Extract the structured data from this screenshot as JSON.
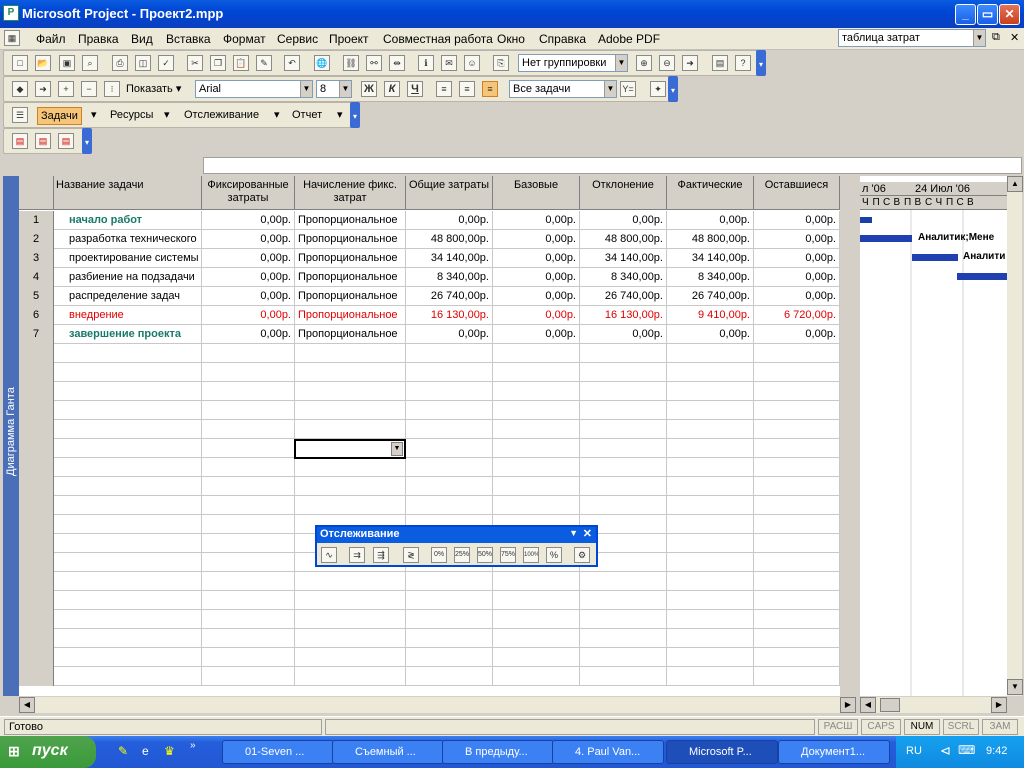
{
  "window": {
    "title": "Microsoft Project - Проект2.mpp",
    "icon": "ms-project-icon",
    "minimize": "_",
    "maximize": "▭",
    "close": "✕"
  },
  "menu": {
    "items": [
      {
        "label": "Файл"
      },
      {
        "label": "Правка"
      },
      {
        "label": "Вид"
      },
      {
        "label": "Вставка"
      },
      {
        "label": "Формат"
      },
      {
        "label": "Сервис"
      },
      {
        "label": "Проект"
      },
      {
        "label": "Совместная работа"
      },
      {
        "label": "Окно"
      },
      {
        "label": "Справка"
      },
      {
        "label": "Adobe PDF"
      }
    ],
    "ask_box": "таблица затрат"
  },
  "toolbar1": {
    "grouping": "Нет группировки"
  },
  "toolbar2": {
    "show_label": "Показать",
    "font": "Arial",
    "size": "8",
    "filter": "Все задачи",
    "bold": "Ж",
    "italic": "К",
    "underline": "Ч"
  },
  "toolbar3": {
    "tasks": "Задачи",
    "resources": "Ресурсы",
    "tracking": "Отслеживание",
    "report": "Отчет"
  },
  "entry_bar": {
    "value": ""
  },
  "view_bar": {
    "label": "Диаграмма Ганта"
  },
  "table": {
    "columns": [
      "Название задачи",
      "Фиксированные затраты",
      "Начисление фикс. затрат",
      "Общие затраты",
      "Базовые",
      "Отклонение",
      "Фактические",
      "Оставшиеся"
    ],
    "rows": [
      {
        "id": "1",
        "name": "начало работ",
        "fixed": "0,00р.",
        "accrual": "Пропорциональное",
        "total": "0,00р.",
        "baseline": "0,00р.",
        "variance": "0,00р.",
        "actual": "0,00р.",
        "remaining": "0,00р.",
        "style": "milestone"
      },
      {
        "id": "2",
        "name": "разработка технического",
        "fixed": "0,00р.",
        "accrual": "Пропорциональное",
        "total": "48 800,00р.",
        "baseline": "0,00р.",
        "variance": "48 800,00р.",
        "actual": "48 800,00р.",
        "remaining": "0,00р.",
        "style": "normal"
      },
      {
        "id": "3",
        "name": "проектирование системы",
        "fixed": "0,00р.",
        "accrual": "Пропорциональное",
        "total": "34 140,00р.",
        "baseline": "0,00р.",
        "variance": "34 140,00р.",
        "actual": "34 140,00р.",
        "remaining": "0,00р.",
        "style": "normal"
      },
      {
        "id": "4",
        "name": "разбиение на подзадачи",
        "fixed": "0,00р.",
        "accrual": "Пропорциональное",
        "total": "8 340,00р.",
        "baseline": "0,00р.",
        "variance": "8 340,00р.",
        "actual": "8 340,00р.",
        "remaining": "0,00р.",
        "style": "normal"
      },
      {
        "id": "5",
        "name": "распределение задач",
        "fixed": "0,00р.",
        "accrual": "Пропорциональное",
        "total": "26 740,00р.",
        "baseline": "0,00р.",
        "variance": "26 740,00р.",
        "actual": "26 740,00р.",
        "remaining": "0,00р.",
        "style": "normal"
      },
      {
        "id": "6",
        "name": "внедрение",
        "fixed": "0,00р.",
        "accrual": "Пропорциональное",
        "total": "16 130,00р.",
        "baseline": "0,00р.",
        "variance": "16 130,00р.",
        "actual": "9 410,00р.",
        "remaining": "6 720,00р.",
        "style": "critical"
      },
      {
        "id": "7",
        "name": "завершение проекта",
        "fixed": "0,00р.",
        "accrual": "Пропорциональное",
        "total": "0,00р.",
        "baseline": "0,00р.",
        "variance": "0,00р.",
        "actual": "0,00р.",
        "remaining": "0,00р.",
        "style": "milestone"
      }
    ],
    "empty_rows": 18
  },
  "gantt": {
    "week1": "л '06",
    "week2": "24 Июл '06",
    "days": [
      "Ч",
      "П",
      "С",
      "В",
      "П",
      "В",
      "С",
      "Ч",
      "П",
      "С",
      "В"
    ],
    "labels": [
      "Аналитик;Мене",
      "Аналити"
    ]
  },
  "tracking_toolbar": {
    "title": "Отслеживание",
    "pcts": [
      "0%",
      "25%",
      "50%",
      "75%",
      "100%"
    ]
  },
  "status": {
    "text": "Готово",
    "indicators": [
      "РАСШ",
      "CAPS",
      "NUM",
      "SCRL",
      "ЗАМ"
    ]
  },
  "taskbar": {
    "start": "пуск",
    "tasks": [
      "01-Seven ...",
      "Съемный ...",
      "В предыду...",
      "4. Paul Van...",
      "Microsoft P...",
      "Документ1..."
    ],
    "lang": "RU",
    "clock": "9:42"
  },
  "colors": {
    "milestone": "#1a7a6a",
    "critical": "#e00000",
    "normal": "#000000"
  }
}
